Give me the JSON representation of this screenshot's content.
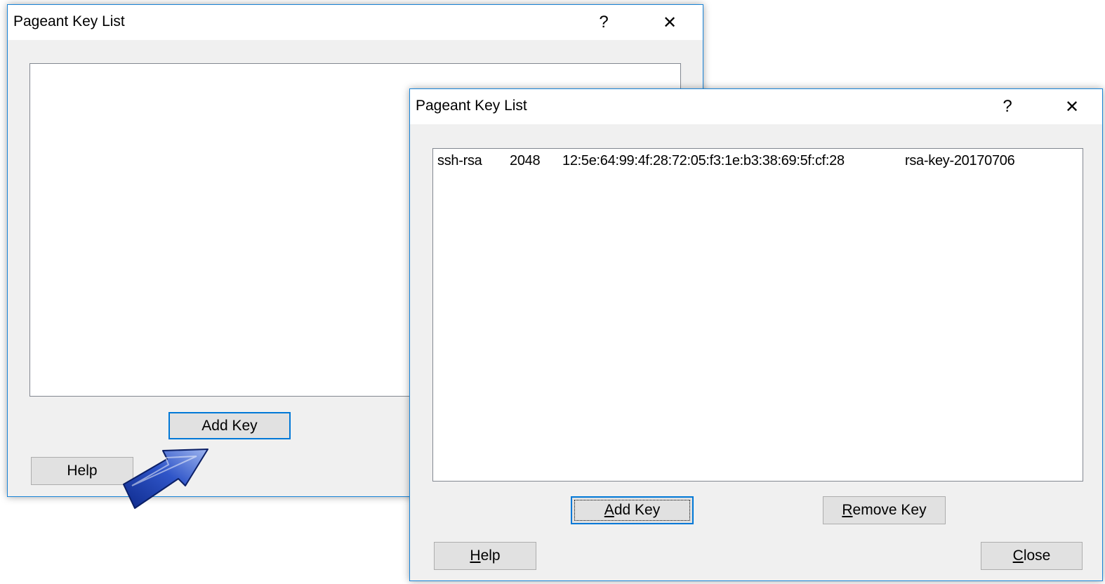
{
  "back_window": {
    "title": "Pageant Key List",
    "help_glyph": "?",
    "close_glyph": "✕",
    "add_key_label": "Add Key",
    "help_label": "Help"
  },
  "front_window": {
    "title": "Pageant Key List",
    "help_glyph": "?",
    "close_glyph": "✕",
    "key_list": [
      {
        "type": "ssh-rsa",
        "bits": "2048",
        "fingerprint": "12:5e:64:99:4f:28:72:05:f3:1e:b3:38:69:5f:cf:28",
        "comment": "rsa-key-20170706"
      }
    ],
    "buttons": {
      "add_key": {
        "mnemonic": "A",
        "rest": "dd Key"
      },
      "remove_key": {
        "mnemonic": "R",
        "rest": "emove Key"
      },
      "help": {
        "mnemonic": "H",
        "rest": "elp"
      },
      "close": {
        "mnemonic": "C",
        "rest": "lose"
      }
    }
  },
  "annotation": {
    "icon": "arrow-icon",
    "color": "#1f3fa8"
  }
}
